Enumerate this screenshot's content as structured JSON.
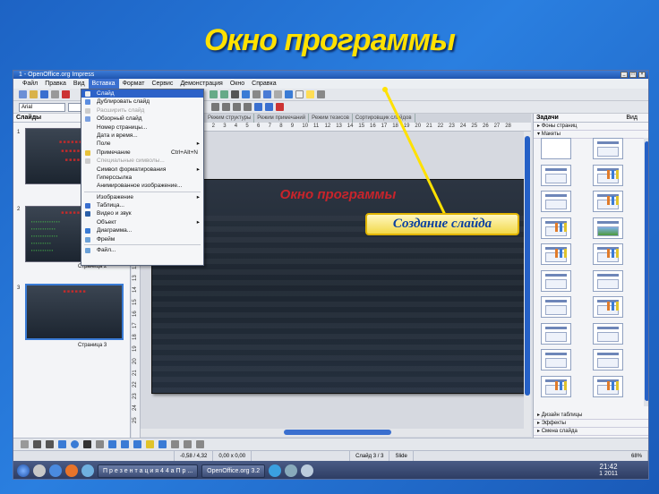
{
  "presentation": {
    "title": "Окно программы",
    "callout": "Создание слайда"
  },
  "window": {
    "title": "1 - OpenOffice.org Impress",
    "menu": [
      "Файл",
      "Правка",
      "Вид",
      "Вставка",
      "Формат",
      "Сервис",
      "Демонстрация",
      "Окно",
      "Справка"
    ],
    "font_name": "Arial",
    "font_size": "",
    "view_tabs": [
      "Режим структуры",
      "Режим примечаний",
      "Режим тезисов",
      "Сортировщик слайдов"
    ],
    "ruler_numbers": [
      "4",
      "3",
      "2",
      "1",
      "0",
      "1",
      "2",
      "3",
      "4",
      "5",
      "6",
      "7",
      "8",
      "9",
      "10",
      "11",
      "12",
      "13",
      "14",
      "15",
      "16",
      "17",
      "18",
      "19",
      "20",
      "21",
      "22",
      "23",
      "24",
      "25",
      "26",
      "27",
      "28"
    ],
    "vruler_numbers": [
      "2",
      "3",
      "4",
      "5",
      "6",
      "7",
      "8",
      "9",
      "10",
      "11",
      "12",
      "13",
      "14",
      "15",
      "16",
      "17",
      "18",
      "19",
      "20",
      "21",
      "22",
      "23",
      "24",
      "25"
    ]
  },
  "insert_menu": {
    "items": [
      {
        "label": "Слайд",
        "highlight": true
      },
      {
        "label": "Дублировать слайд"
      },
      {
        "label": "Расширить слайд",
        "disabled": true
      },
      {
        "label": "Обзорный слайд"
      },
      {
        "label": "Номер страницы..."
      },
      {
        "label": "Дата и время..."
      },
      {
        "label": "Поле",
        "submenu": true
      },
      {
        "label": "Примечание",
        "shortcut": "Ctrl+Alt+N"
      },
      {
        "label": "Специальные символы...",
        "disabled": true
      },
      {
        "label": "Символ форматирования",
        "submenu": true
      },
      {
        "label": "Гиперссылка"
      },
      {
        "label": "Анимированное изображение..."
      },
      {
        "sep": true
      },
      {
        "label": "Изображение",
        "submenu": true
      },
      {
        "label": "Таблица..."
      },
      {
        "label": "Видео и звук"
      },
      {
        "label": "Объект",
        "submenu": true
      },
      {
        "label": "Диаграмма..."
      },
      {
        "label": "Фрейм"
      },
      {
        "sep": true
      },
      {
        "label": "Файл..."
      }
    ]
  },
  "slides_pane": {
    "title": "Слайды",
    "slides": [
      {
        "num": "1",
        "label": ""
      },
      {
        "num": "2",
        "label": "Страница 2"
      },
      {
        "num": "3",
        "label": "Страница 3"
      }
    ]
  },
  "canvas": {
    "slide_title": "Окно программы"
  },
  "tasks_pane": {
    "title": "Задачи",
    "view_label": "Вид",
    "sections_top": [
      "Фоны страниц",
      "Макеты"
    ],
    "sections_bottom": [
      "Дизайн таблицы",
      "Эффекты",
      "Смена слайда"
    ]
  },
  "status": {
    "position": "-0,58 / 4,32",
    "size": "0,00 x 0,00",
    "slide": "Слайд 3 / 3",
    "design": "Slide",
    "zoom": "68%"
  },
  "taskbar": {
    "items": [
      "П р е з е н т а ц и я   4 4 а   П р ...",
      "OpenOffice.org 3.2"
    ],
    "time": "21:42",
    "date": "1 2011"
  },
  "colors": {
    "title_yellow": "#ffe100",
    "accent_blue": "#2d62c8",
    "slide_red": "#c8242b"
  }
}
